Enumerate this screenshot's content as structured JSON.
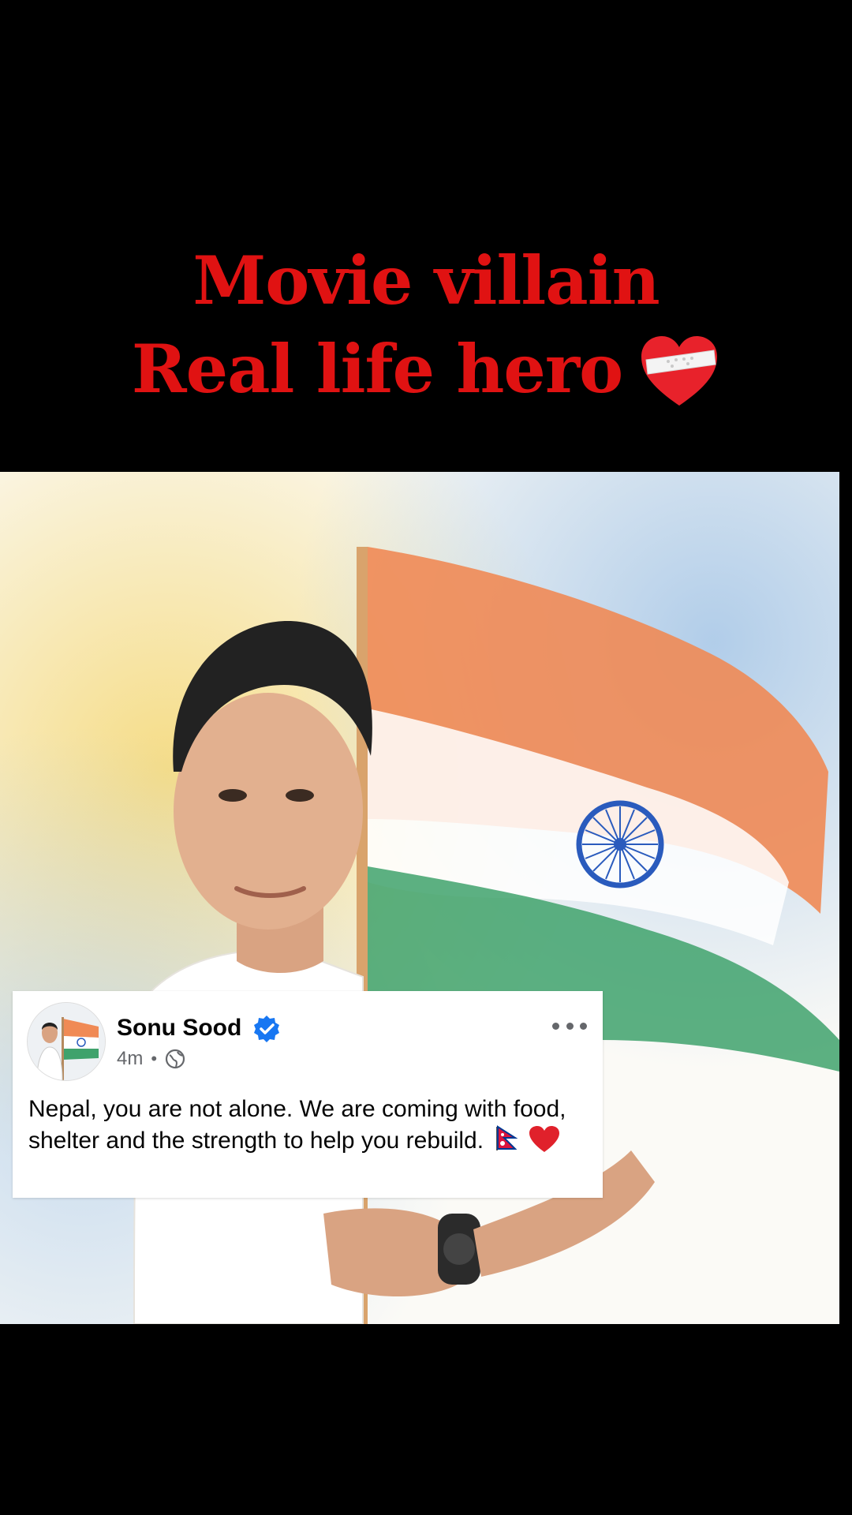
{
  "headline": {
    "line1": "Movie villain",
    "line2": "Real life hero",
    "emoji": "mending-heart-icon",
    "color": "#e01212"
  },
  "image": {
    "subject": "man-with-indian-flag-illustration"
  },
  "post": {
    "author": "Sonu Sood",
    "verified": true,
    "time": "4m",
    "separator": "•",
    "audience_icon": "globe-icon",
    "text": "Nepal, you are not alone. We are coming with food, shelter and the strength to help you rebuild.",
    "emojis": [
      "nepal-flag-icon",
      "red-heart-icon"
    ],
    "accent": "#1877f2"
  }
}
